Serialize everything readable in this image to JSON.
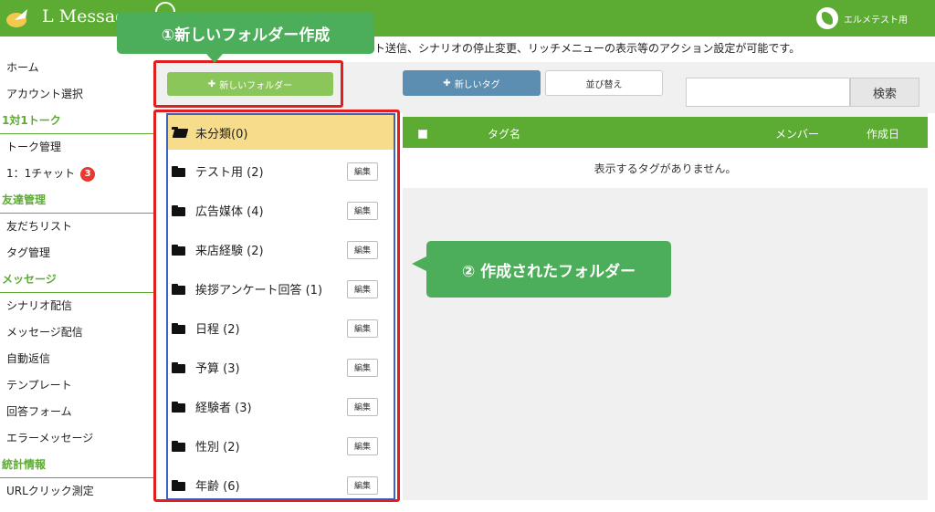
{
  "header": {
    "brand": "L Messag",
    "account_name": "エルメテスト用"
  },
  "sidebar": {
    "items": [
      {
        "label": "ホーム",
        "type": "item"
      },
      {
        "label": "アカウント選択",
        "type": "item"
      },
      {
        "label": "1対1トーク",
        "type": "heading"
      },
      {
        "label": "トーク管理",
        "type": "item"
      },
      {
        "label": "1：1チャット",
        "type": "item",
        "badge": "3"
      },
      {
        "label": "友達管理",
        "type": "heading"
      },
      {
        "label": "友だちリスト",
        "type": "item"
      },
      {
        "label": "タグ管理",
        "type": "item"
      },
      {
        "label": "メッセージ",
        "type": "heading"
      },
      {
        "label": "シナリオ配信",
        "type": "item"
      },
      {
        "label": "メッセージ配信",
        "type": "item"
      },
      {
        "label": "自動返信",
        "type": "item"
      },
      {
        "label": "テンプレート",
        "type": "item"
      },
      {
        "label": "回答フォーム",
        "type": "item"
      },
      {
        "label": "エラーメッセージ",
        "type": "item"
      },
      {
        "label": "統計情報",
        "type": "heading"
      },
      {
        "label": "URLクリック測定",
        "type": "item"
      }
    ]
  },
  "main": {
    "description": "ート送信、シナリオの停止変更、リッチメニューの表示等のアクション設定が可能です。",
    "new_folder_label": "新しいフォルダー",
    "new_tag_label": "新しいタグ",
    "sort_label": "並び替え",
    "search_button": "検索",
    "search_value": "",
    "plus_glyph": "✚"
  },
  "folders": [
    {
      "label": "未分類(0)",
      "selected": true
    },
    {
      "label": "テスト用 (2)",
      "edit": "編集"
    },
    {
      "label": "広告媒体 (4)",
      "edit": "編集"
    },
    {
      "label": "来店経験 (2)",
      "edit": "編集"
    },
    {
      "label": "挨拶アンケート回答 (1)",
      "edit": "編集"
    },
    {
      "label": "日程 (2)",
      "edit": "編集"
    },
    {
      "label": "予算 (3)",
      "edit": "編集"
    },
    {
      "label": "経験者 (3)",
      "edit": "編集"
    },
    {
      "label": "性別 (2)",
      "edit": "編集"
    },
    {
      "label": "年齢 (6)",
      "edit": "編集"
    }
  ],
  "tag_table": {
    "columns": [
      "タグ名",
      "メンバー",
      "作成日"
    ],
    "empty_message": "表示するタグがありません。"
  },
  "annotations": {
    "callout_1": "①新しいフォルダー作成",
    "callout_2": "② 作成されたフォルダー"
  },
  "colors": {
    "brand_green": "#5cab32",
    "callout_green": "#4cae5a",
    "highlight_red": "#e02020",
    "selected_folder": "#f7dc8c",
    "badge_red": "#e8382f"
  }
}
